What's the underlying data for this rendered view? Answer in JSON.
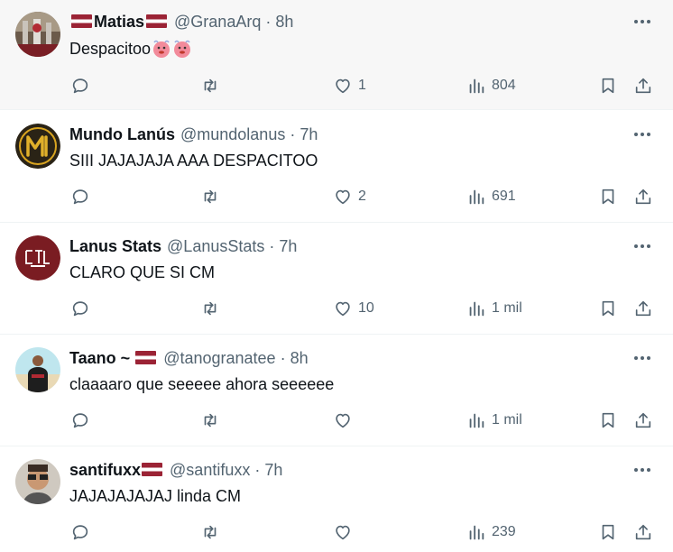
{
  "tweets": [
    {
      "name": "Matias",
      "flag_before_name": true,
      "flag_after_name": true,
      "handle": "@GranaArq",
      "time": "8h",
      "text": "Despacitoo",
      "emojis": [
        "face-with-steam-icon",
        "face-with-steam-icon"
      ],
      "likes": "1",
      "views": "804",
      "highlighted": true,
      "avatar": "trophy-photo"
    },
    {
      "name": "Mundo Lanús",
      "flag_before_name": false,
      "flag_after_name": false,
      "handle": "@mundolanus",
      "time": "7h",
      "text": "SIII JAJAJAJA AAA DESPACITOO",
      "emojis": [],
      "likes": "2",
      "views": "691",
      "highlighted": false,
      "avatar": "gold-logo"
    },
    {
      "name": "Lanus Stats",
      "flag_before_name": false,
      "flag_after_name": false,
      "handle": "@LanusStats",
      "time": "7h",
      "text": "CLARO QUE SI CM",
      "emojis": [],
      "likes": "10",
      "views": "1 mil",
      "highlighted": false,
      "avatar": "stats-logo"
    },
    {
      "name": "Taano ~",
      "flag_before_name": false,
      "flag_after_name": true,
      "handle": "@tanogranatee",
      "time": "8h",
      "text": "claaaaro que seeeee ahora seeeeee",
      "emojis": [],
      "likes": "",
      "views": "1 mil",
      "highlighted": false,
      "avatar": "beach-photo"
    },
    {
      "name": "santifuxx",
      "flag_before_name": false,
      "flag_after_name": true,
      "handle": "@santifuxx",
      "time": "7h",
      "text": "JAJAJAJAJAJ linda CM",
      "emojis": [],
      "likes": "",
      "views": "239",
      "highlighted": false,
      "avatar": "selfie-photo"
    }
  ],
  "separator": "·",
  "colors": {
    "text": "#0f1419",
    "muted": "#536471",
    "flag_red": "#9b2335",
    "border": "#eff3f4"
  }
}
